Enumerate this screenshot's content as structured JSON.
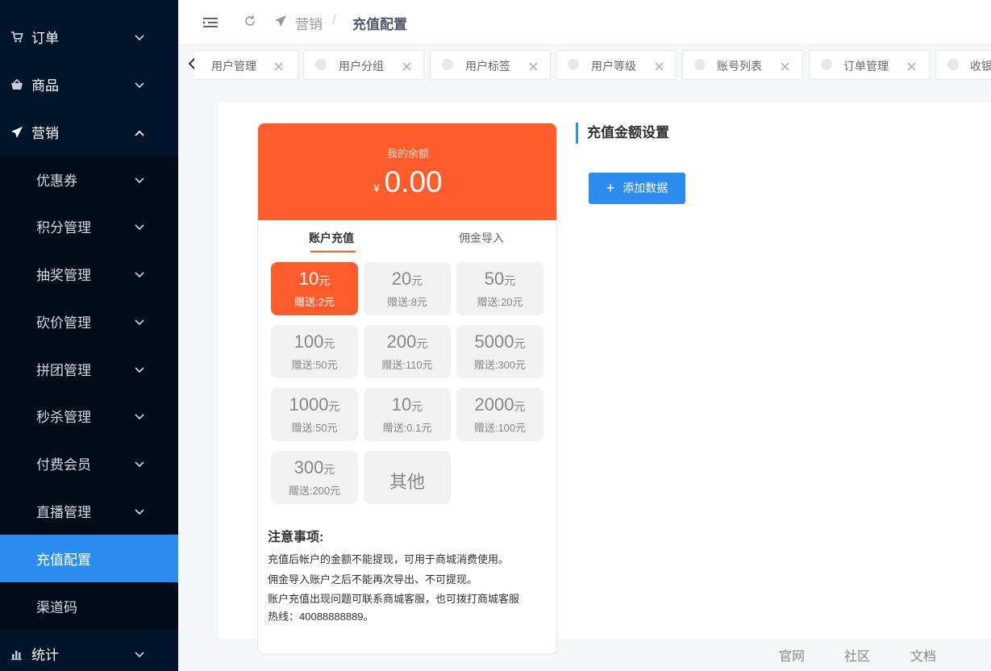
{
  "sidebar": {
    "items": [
      {
        "label": "订单",
        "icon": "cart-icon"
      },
      {
        "label": "商品",
        "icon": "basket-icon"
      },
      {
        "label": "营销",
        "icon": "paper-plane-icon"
      },
      {
        "label": "统计",
        "icon": "bar-chart-icon"
      }
    ],
    "submenu": [
      {
        "label": "优惠券"
      },
      {
        "label": "积分管理"
      },
      {
        "label": "抽奖管理"
      },
      {
        "label": "砍价管理"
      },
      {
        "label": "拼团管理"
      },
      {
        "label": "秒杀管理"
      },
      {
        "label": "付费会员"
      },
      {
        "label": "直播管理"
      },
      {
        "label": "充值配置"
      },
      {
        "label": "渠道码"
      }
    ]
  },
  "header": {
    "breadcrumb_parent": "营销",
    "breadcrumb_sep": "/",
    "breadcrumb_current": "充值配置"
  },
  "tabs": [
    "用户管理",
    "用户分组",
    "用户标签",
    "用户等级",
    "账号列表",
    "订单管理",
    "收银"
  ],
  "phone": {
    "balance_label": "我的余额",
    "currency": "¥",
    "balance": "0.00",
    "tab_active": "账户充值",
    "tab_other": "佣金导入",
    "unit": "元",
    "amounts": [
      {
        "value": "10",
        "gift": "赠送:2元"
      },
      {
        "value": "20",
        "gift": "赠送:8元"
      },
      {
        "value": "50",
        "gift": "赠送:20元"
      },
      {
        "value": "100",
        "gift": "赠送:50元"
      },
      {
        "value": "200",
        "gift": "赠送:110元"
      },
      {
        "value": "5000",
        "gift": "赠送:300元"
      },
      {
        "value": "1000",
        "gift": "赠送:50元"
      },
      {
        "value": "10",
        "gift": "赠送:0.1元"
      },
      {
        "value": "2000",
        "gift": "赠送:100元"
      },
      {
        "value": "300",
        "gift": "赠送:200元"
      }
    ],
    "other_label": "其他",
    "notes_title": "注意事项:",
    "notes": [
      "充值后帐户的金额不能提现，可用于商城消费使用。",
      "佣金导入账户之后不能再次导出、不可提现。",
      "账户充值出现问题可联系商城客服，也可拨打商城客服",
      "热线：40088888889。"
    ]
  },
  "panel": {
    "title": "充值金额设置",
    "add_button": "添加数据",
    "add_icon": "+"
  },
  "footer": {
    "links": [
      "官网",
      "社区",
      "文档"
    ]
  },
  "colors": {
    "sidebar_bg": "#001529",
    "submenu_bg": "#000c17",
    "accent": "#2d8cf0",
    "orange": "#ff5c2e"
  }
}
